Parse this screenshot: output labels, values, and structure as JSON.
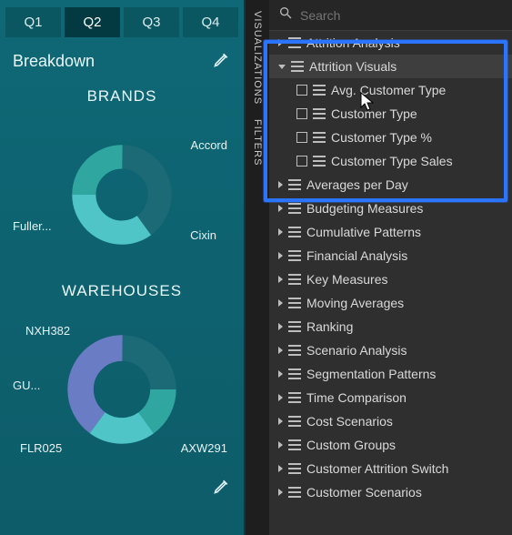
{
  "tabs": {
    "q1": "Q1",
    "q2": "Q2",
    "q3": "Q3",
    "q4": "Q4"
  },
  "activeTab": "q2",
  "breakdownLabel": "Breakdown",
  "sections": {
    "brands": "BRANDS",
    "warehouses": "WAREHOUSES"
  },
  "brandLabels": {
    "accord": "Accord",
    "cixin": "Cixin",
    "fuller": "Fuller..."
  },
  "warehouseLabels": {
    "nxh": "NXH382",
    "gu": "GU...",
    "flr": "FLR025",
    "axw": "AXW291"
  },
  "search": {
    "placeholder": "Search"
  },
  "sidePanels": {
    "viz": "VISUALIZATIONS",
    "filters": "FILTERS"
  },
  "tree": {
    "attritionAnalysis": "Attrition Analysis",
    "attritionVisuals": "Attrition Visuals",
    "avgCustomerType": "Avg. Customer Type",
    "customerType": "Customer Type",
    "customerTypePct": "Customer Type %",
    "customerTypeSales": "Customer Type Sales",
    "averagesPerDay": "Averages per Day",
    "budgetingMeasures": "Budgeting Measures",
    "cumulativePatterns": "Cumulative Patterns",
    "financialAnalysis": "Financial Analysis",
    "keyMeasures": "Key Measures",
    "movingAverages": "Moving Averages",
    "ranking": "Ranking",
    "scenarioAnalysis": "Scenario Analysis",
    "segmentationPatterns": "Segmentation Patterns",
    "timeComparison": "Time Comparison",
    "costScenarios": "Cost Scenarios",
    "customGroups": "Custom Groups",
    "customerAttritionSwitch": "Customer Attrition Switch",
    "customerScenarios": "Customer Scenarios"
  },
  "chart_data": [
    {
      "type": "pie",
      "title": "BRANDS",
      "series": [
        {
          "name": "Accord",
          "value": 40,
          "color": "#1b6a76"
        },
        {
          "name": "Cixin",
          "value": 35,
          "color": "#4fc5c8"
        },
        {
          "name": "Fuller",
          "value": 25,
          "color": "#2fa7a0"
        }
      ]
    },
    {
      "type": "pie",
      "title": "WAREHOUSES",
      "series": [
        {
          "name": "NXH382",
          "value": 25,
          "color": "#1b6a76"
        },
        {
          "name": "GU",
          "value": 15,
          "color": "#2fa7a0"
        },
        {
          "name": "FLR025",
          "value": 20,
          "color": "#4fc5c8"
        },
        {
          "name": "AXW291",
          "value": 40,
          "color": "#6a7dc4"
        }
      ]
    }
  ]
}
